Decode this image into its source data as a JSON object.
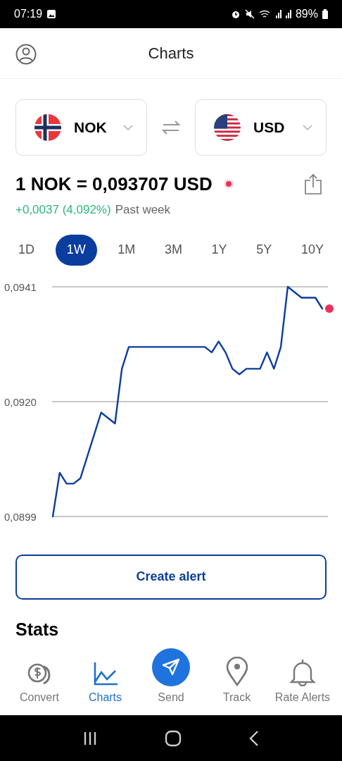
{
  "status_bar": {
    "time": "07:19",
    "battery": "89%"
  },
  "header": {
    "title": "Charts"
  },
  "currency_pair": {
    "from": {
      "code": "NOK",
      "kind": "norway"
    },
    "to": {
      "code": "USD",
      "kind": "usa"
    }
  },
  "rate": {
    "text": "1 NOK = 0,093707 USD",
    "change": "+0,0037 (4,092%)",
    "period": "Past week"
  },
  "periods": [
    {
      "label": "1D",
      "selected": false
    },
    {
      "label": "1W",
      "selected": true
    },
    {
      "label": "1M",
      "selected": false
    },
    {
      "label": "3M",
      "selected": false
    },
    {
      "label": "1Y",
      "selected": false
    },
    {
      "label": "5Y",
      "selected": false
    },
    {
      "label": "10Y",
      "selected": false
    }
  ],
  "chart": {
    "chart_data": {
      "type": "line",
      "ylim": [
        0.0899,
        0.0941
      ],
      "yticks": [
        {
          "value": 0.0941,
          "label": "0,0941"
        },
        {
          "value": 0.092,
          "label": "0,0920"
        },
        {
          "value": 0.0899,
          "label": "0,0899"
        }
      ],
      "series": [
        {
          "color": "#0b3d9e",
          "values": [
            0.0899,
            0.0907,
            0.0905,
            0.0905,
            0.0906,
            0.091,
            0.0914,
            0.0918,
            0.0917,
            0.0916,
            0.0926,
            0.093,
            0.093,
            0.093,
            0.093,
            0.093,
            0.093,
            0.093,
            0.093,
            0.093,
            0.093,
            0.093,
            0.093,
            0.0929,
            0.0931,
            0.0929,
            0.0926,
            0.0925,
            0.0926,
            0.0926,
            0.0926,
            0.0929,
            0.0926,
            0.093,
            0.0941,
            0.094,
            0.0939,
            0.0939,
            0.0939,
            0.0937
          ]
        }
      ]
    }
  },
  "create_alert": "Create alert",
  "stats_heading": "Stats",
  "bottom_nav": [
    {
      "label": "Convert",
      "kind": "convert",
      "selected": false
    },
    {
      "label": "Charts",
      "kind": "charts",
      "selected": true
    },
    {
      "label": "Send",
      "kind": "send",
      "selected": false
    },
    {
      "label": "Track",
      "kind": "track",
      "selected": false
    },
    {
      "label": "Rate Alerts",
      "kind": "alerts",
      "selected": false
    }
  ]
}
